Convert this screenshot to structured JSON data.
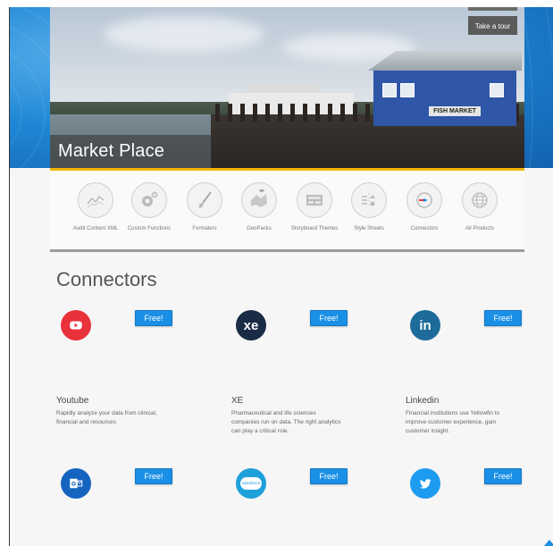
{
  "hero": {
    "title": "Market Place",
    "tour_button": "Take a tour",
    "sign_text": "FISH MARKET"
  },
  "categories": [
    {
      "label": "Audit Content XML",
      "icon": "chart-icon"
    },
    {
      "label": "Custom Functions",
      "icon": "gears-icon"
    },
    {
      "label": "Formaters",
      "icon": "brush-icon"
    },
    {
      "label": "GeoPacks",
      "icon": "map-pin-icon"
    },
    {
      "label": "Storyboard Themes",
      "icon": "storyboard-icon"
    },
    {
      "label": "Style Sheets",
      "icon": "stylesheet-icon"
    },
    {
      "label": "Connectors",
      "icon": "connector-icon"
    },
    {
      "label": "All Products",
      "icon": "globe-icon"
    }
  ],
  "section": {
    "title": "Connectors"
  },
  "connectors": [
    {
      "name": "Youtube",
      "desc": "Rapidly analyze your data from clinical, financial and resources",
      "free": "Free!",
      "logo_text": "▶",
      "color": "#e8313b"
    },
    {
      "name": "XE",
      "desc": "Pharmaceutical and life sciences companies run on data. The right analytics can play a critical role.",
      "free": "Free!",
      "logo_text": "xe",
      "color": "#1a2b45"
    },
    {
      "name": "Linkedin",
      "desc": "Financial institutions use Yellowfin to improve customer experience, gain customer insight.",
      "free": "Free!",
      "logo_text": "in",
      "color": "#1c6b9a"
    },
    {
      "name": "",
      "desc": "",
      "free": "Free!",
      "logo_text": "O",
      "color": "#1565c0"
    },
    {
      "name": "",
      "desc": "",
      "free": "Free!",
      "logo_text": "salesforce",
      "color": "#1ea0db"
    },
    {
      "name": "",
      "desc": "",
      "free": "Free!",
      "logo_text": "•",
      "color": "#1d9bf0"
    }
  ]
}
